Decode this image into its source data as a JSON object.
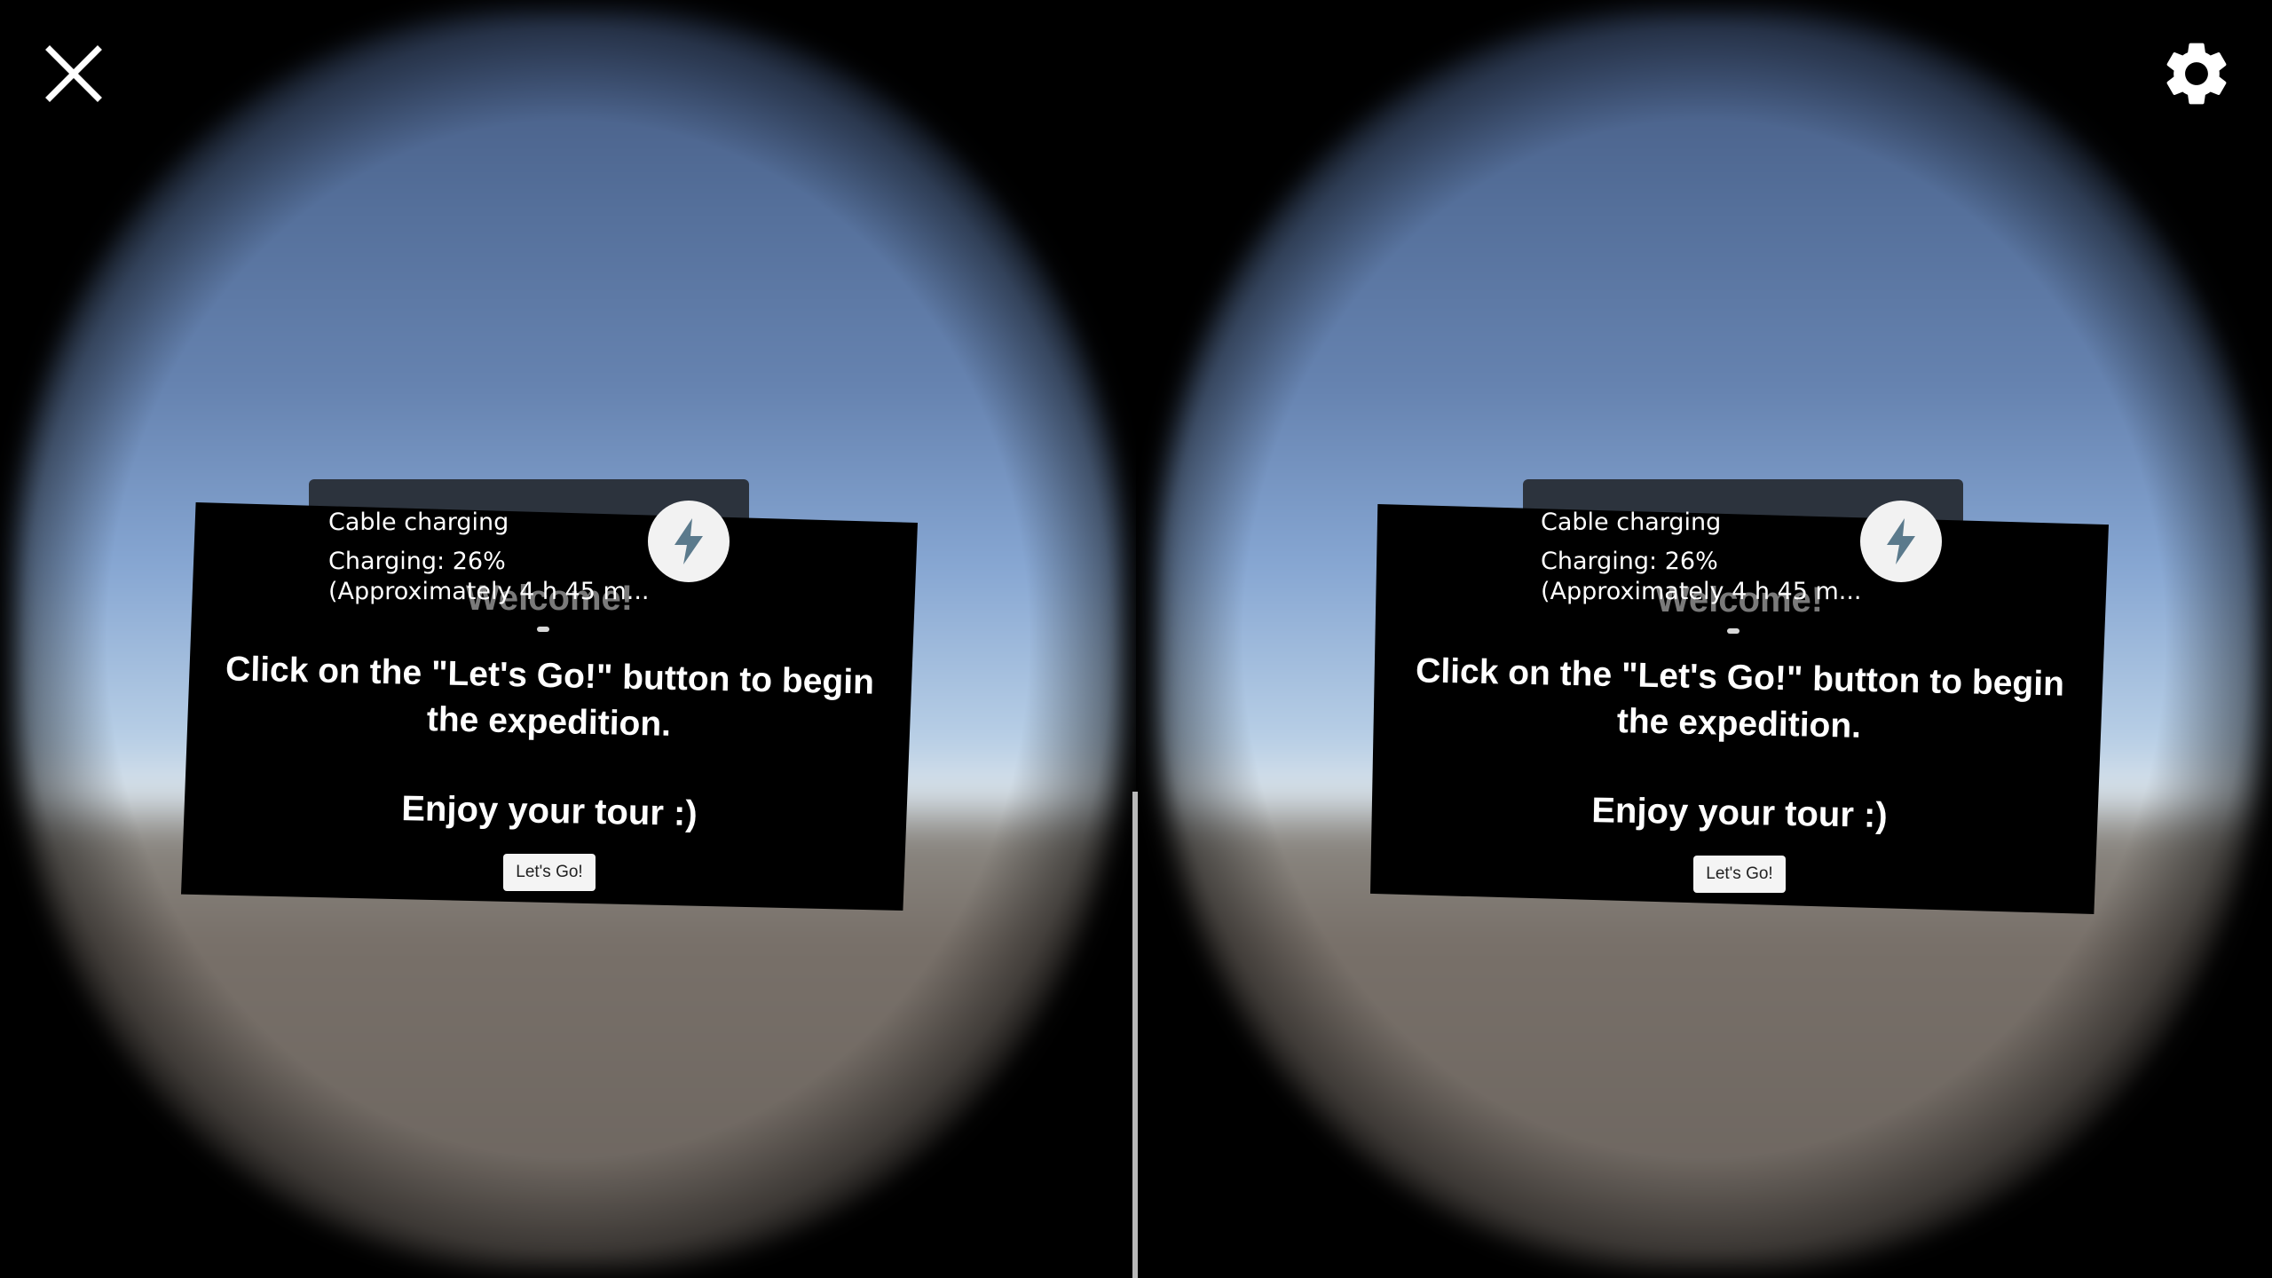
{
  "battery_toast": {
    "title": "Cable charging",
    "status": "Charging: 26%",
    "estimate": "(Approximately 4 h 45 m...",
    "icon": "lightning-bolt-icon"
  },
  "panel": {
    "welcome": "Welcome!",
    "instruction": "Click on the \"Let's Go!\" button to begin the expedition.",
    "enjoy": "Enjoy your tour :)",
    "button_label": "Let's Go!"
  },
  "controls": {
    "close_icon": "close-icon",
    "settings_icon": "gear-icon"
  },
  "colors": {
    "sky_top": "#43587f",
    "horizon": "#d8e2ea",
    "ground": "#6b645e",
    "toast_bg": "#2c333d",
    "bolt_color": "#5b7a8c"
  }
}
